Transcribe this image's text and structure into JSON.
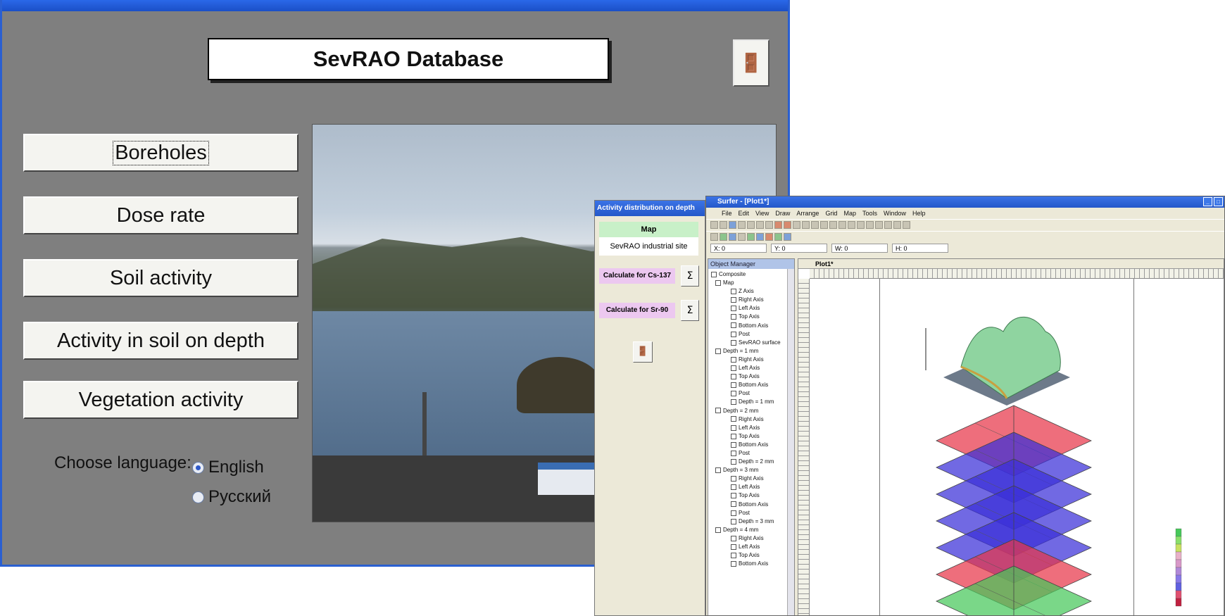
{
  "main_window": {
    "title": "",
    "app_title": "SevRAO Database",
    "exit_icon": "door-exit-icon",
    "menu_buttons": [
      {
        "label": "Boreholes"
      },
      {
        "label": "Dose rate"
      },
      {
        "label": "Soil activity"
      },
      {
        "label": "Activity in soil on depth"
      },
      {
        "label": "Vegetation activity"
      }
    ],
    "language": {
      "label": "Choose language:",
      "options": [
        {
          "label": "English",
          "selected": true
        },
        {
          "label": "Русский",
          "selected": false
        }
      ]
    },
    "photo": "harbor-landscape-photo"
  },
  "activity_dialog": {
    "title": "Activity distribution on depth",
    "map_header": "Map",
    "map_value": "SevRAO industrial site",
    "calc_cs": "Calculate for Cs-137",
    "calc_sr": "Calculate for Sr-90",
    "sigma_label": "Σ",
    "exit_icon": "door-exit-icon"
  },
  "surfer_window": {
    "title": "Surfer - [Plot1*]",
    "menu": [
      "File",
      "Edit",
      "View",
      "Draw",
      "Arrange",
      "Grid",
      "Map",
      "Tools",
      "Window",
      "Help"
    ],
    "coords": {
      "x": "X: 0",
      "y": "Y: 0",
      "w": "W: 0",
      "h": "H: 0"
    },
    "object_manager_title": "Object Manager",
    "plot_tab": "Plot1*",
    "tree": [
      {
        "level": 0,
        "label": "Composite"
      },
      {
        "level": 1,
        "label": "Map"
      },
      {
        "level": 2,
        "label": "Z Axis"
      },
      {
        "level": 2,
        "label": "Right Axis"
      },
      {
        "level": 2,
        "label": "Left Axis"
      },
      {
        "level": 2,
        "label": "Top Axis"
      },
      {
        "level": 2,
        "label": "Bottom Axis"
      },
      {
        "level": 2,
        "label": "Post"
      },
      {
        "level": 2,
        "label": "SevRAO surface"
      },
      {
        "level": 1,
        "label": "Depth = 1 mm"
      },
      {
        "level": 2,
        "label": "Right Axis"
      },
      {
        "level": 2,
        "label": "Left Axis"
      },
      {
        "level": 2,
        "label": "Top Axis"
      },
      {
        "level": 2,
        "label": "Bottom Axis"
      },
      {
        "level": 2,
        "label": "Post"
      },
      {
        "level": 2,
        "label": "Depth = 1 mm"
      },
      {
        "level": 1,
        "label": "Depth = 2 mm"
      },
      {
        "level": 2,
        "label": "Right Axis"
      },
      {
        "level": 2,
        "label": "Left Axis"
      },
      {
        "level": 2,
        "label": "Top Axis"
      },
      {
        "level": 2,
        "label": "Bottom Axis"
      },
      {
        "level": 2,
        "label": "Post"
      },
      {
        "level": 2,
        "label": "Depth = 2 mm"
      },
      {
        "level": 1,
        "label": "Depth = 3 mm"
      },
      {
        "level": 2,
        "label": "Right Axis"
      },
      {
        "level": 2,
        "label": "Left Axis"
      },
      {
        "level": 2,
        "label": "Top Axis"
      },
      {
        "level": 2,
        "label": "Bottom Axis"
      },
      {
        "level": 2,
        "label": "Post"
      },
      {
        "level": 2,
        "label": "Depth = 3 mm"
      },
      {
        "level": 1,
        "label": "Depth = 4 mm"
      },
      {
        "level": 2,
        "label": "Right Axis"
      },
      {
        "level": 2,
        "label": "Left Axis"
      },
      {
        "level": 2,
        "label": "Top Axis"
      },
      {
        "level": 2,
        "label": "Bottom Axis"
      }
    ],
    "layer_colors": [
      "#e8364a",
      "#3a2fd8",
      "#3a2fd8",
      "#3a2fd8",
      "#3a2fd8",
      "#e8364a",
      "#46c85a"
    ]
  }
}
